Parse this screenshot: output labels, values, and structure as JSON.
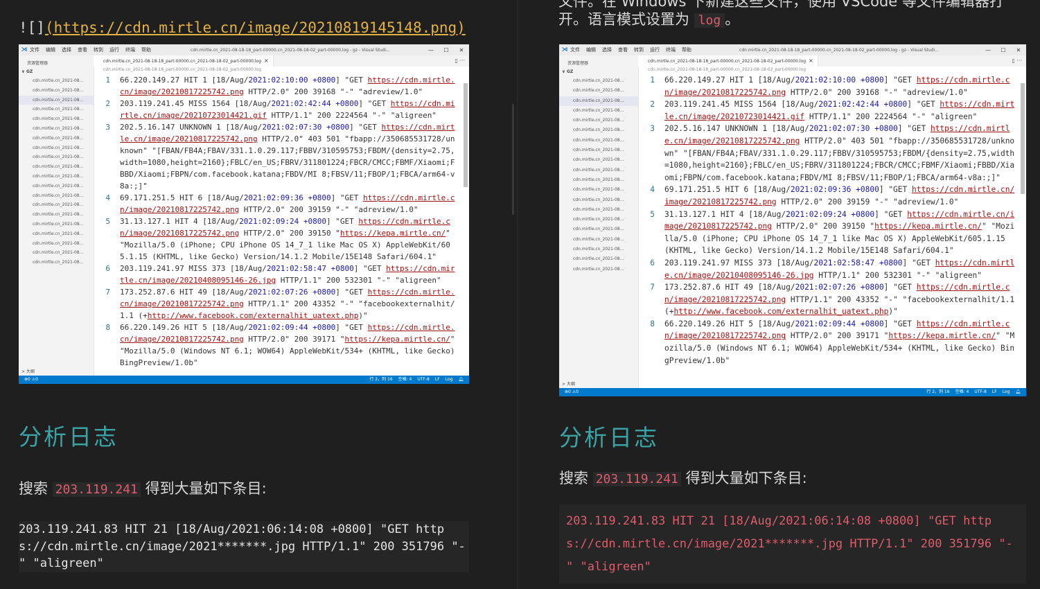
{
  "left": {
    "image_link": {
      "prefix": "![]",
      "url": "(https://cdn.mirtle.cn/image/20210819145148.png)"
    },
    "heading": "分析日志",
    "search_para": {
      "before": "搜索 ",
      "code": "203.119.241",
      "after": " 得到大量如下条目:"
    },
    "code_block": "203.119.241.83 HIT 21 [18/Aug/2021:06:14:08 +0800] \"GET https://cdn.mirtle.cn/image/2021*******.jpg HTTP/1.1\" 200 351796 \"-\" \"aligreen\""
  },
  "right": {
    "top_partial": "文件。在 Windows 下新建这些文件，使用 VSCode 等文件编辑器打",
    "top_line": {
      "before": "开。语言模式设置为 ",
      "code": "log",
      "after": "。"
    },
    "heading": "分析日志",
    "search_para": {
      "before": "搜索 ",
      "code": "203.119.241",
      "after": " 得到大量如下条目:"
    },
    "code_block": "203.119.241.83 HIT 21 [18/Aug/2021:06:14:08 +0800] \"GET https://cdn.mirtle.cn/image/2021*******.jpg HTTP/1.1\" 200 351796 \"-\" \"aligreen\""
  },
  "vscode": {
    "menu": [
      "文件",
      "编辑",
      "选择",
      "查看",
      "转到",
      "运行",
      "终端",
      "帮助"
    ],
    "window_title": "cdn.mirtle.cn_2021-08-18-18_part-00000.cn_2021-08-18-02_part-00000.log - gz - Visual Studi...",
    "explorer_label": "资源管理器",
    "folder": "GZ",
    "file_item": "cdn.mirtle.cn_2021-08...",
    "outline_label": "大纲",
    "tab_label": "cdn.mirtle.cn_2021-08-18-18_part-00000.cn_2021-08-18-02_part-00000.log",
    "breadcrumb": "cdn.mirtle.cn_2021-08-18-18_part-00000.cn_2021-08-18-02_part-00000.log",
    "status_left": "⊗0 ⚠0",
    "status_right": [
      "行 2，列 16",
      "空格: 4",
      "UTF-8",
      "LF",
      "Log"
    ],
    "lines": [
      {
        "n": "1",
        "segs": [
          [
            "",
            "66.220.149.27 HIT 1 [18/Aug/"
          ],
          [
            "dt",
            "2021:02:10:00 +0800"
          ],
          [
            "",
            "] \"GET "
          ],
          [
            "u",
            "https://cdn.mirtle.cn/image/20210817225742.png"
          ],
          [
            "",
            " HTTP/2.0\" 200 39168 \"-\" \"adreview/1.0\""
          ]
        ]
      },
      {
        "n": "2",
        "segs": [
          [
            "",
            "203.119.241.45 MISS 1564 [18/Aug/"
          ],
          [
            "dt",
            "2021:02:42:44 +0800"
          ],
          [
            "",
            "] \"GET "
          ],
          [
            "u",
            "https://cdn.mirtle.cn/image/20210723014421.gif"
          ],
          [
            "",
            " HTTP/1.1\" 200 2224564 \"-\" \"aligreen\""
          ]
        ]
      },
      {
        "n": "3",
        "segs": [
          [
            "",
            "202.5.16.147 UNKNOWN 1 [18/Aug/"
          ],
          [
            "dt",
            "2021:02:07:30 +0800"
          ],
          [
            "",
            "] \"GET "
          ],
          [
            "u",
            "https://cdn.mirtle.cn/image/20210817225742.png"
          ],
          [
            "",
            " HTTP/2.0\" 403 501 \"fbapp://350685531728/unknown\" \"[FBAN/FB4A;FBAV/331.1.0.29.117;FBBV/310595753;FBDM/{density=2.75,width=1080,height=2160};FBLC/en_US;FBRV/311801224;FBCR/CMCC;FBMF/Xiaomi;FBBD/Xiaomi;FBPN/com.facebook.katana;FBDV/MI 8;FBSV/11;FBOP/1;FBCA/arm64-v8a:;]\""
          ]
        ]
      },
      {
        "n": "4",
        "segs": [
          [
            "",
            "69.171.251.5 HIT 6 [18/Aug/"
          ],
          [
            "dt",
            "2021:02:09:36 +0800"
          ],
          [
            "",
            "] \"GET "
          ],
          [
            "u",
            "https://cdn.mirtle.cn/image/20210817225742.png"
          ],
          [
            "",
            " HTTP/2.0\" 200 39159 \"-\" \"adreview/1.0\""
          ]
        ]
      },
      {
        "n": "5",
        "segs": [
          [
            "",
            "31.13.127.1 HIT 4 [18/Aug/"
          ],
          [
            "dt",
            "2021:02:09:24 +0800"
          ],
          [
            "",
            "] \"GET "
          ],
          [
            "u",
            "https://cdn.mirtle.cn/image/20210817225742.png"
          ],
          [
            "",
            " HTTP/2.0\" 200 39150 \""
          ],
          [
            "u",
            "https://kepa.mirtle.cn/"
          ],
          [
            "",
            "\" \"Mozilla/5.0 (iPhone; CPU iPhone OS 14_7_1 like Mac OS X) AppleWebKit/605.1.15 (KHTML, like Gecko) Version/14.1.2 Mobile/15E148 Safari/604.1\""
          ]
        ]
      },
      {
        "n": "6",
        "segs": [
          [
            "",
            "203.119.241.97 MISS 373 [18/Aug/"
          ],
          [
            "dt",
            "2021:02:58:47 +0800"
          ],
          [
            "",
            "] \"GET "
          ],
          [
            "u",
            "https://cdn.mirtle.cn/image/20210408095146-26.jpg"
          ],
          [
            "",
            " HTTP/1.1\" 200 532301 \"-\" \"aligreen\""
          ]
        ]
      },
      {
        "n": "7",
        "segs": [
          [
            "",
            "173.252.87.6 HIT 49 [18/Aug/"
          ],
          [
            "dt",
            "2021:02:07:26 +0800"
          ],
          [
            "",
            "] \"GET "
          ],
          [
            "u",
            "https://cdn.mirtle.cn/image/20210817225742.png"
          ],
          [
            "",
            " HTTP/1.1\" 200 43352 \"-\" \"facebookexternalhit/1.1 (+"
          ],
          [
            "u",
            "http://www.facebook.com/externalhit_uatext.php"
          ],
          [
            "",
            ")\""
          ]
        ]
      },
      {
        "n": "8",
        "segs": [
          [
            "",
            "66.220.149.26 HIT 5 [18/Aug/"
          ],
          [
            "dt",
            "2021:02:09:44 +0800"
          ],
          [
            "",
            "] \"GET "
          ],
          [
            "u",
            "https://cdn.mirtle.cn/image/20210817225742.png"
          ],
          [
            "",
            " HTTP/2.0\" 200 39171 \""
          ],
          [
            "u",
            "https://kepa.mirtle.cn/"
          ],
          [
            "",
            "\" \"Mozilla/5.0 (Windows NT 6.1; WOW64) AppleWebKit/534+ (KHTML, like Gecko) BingPreview/1.0b\""
          ]
        ]
      }
    ]
  }
}
